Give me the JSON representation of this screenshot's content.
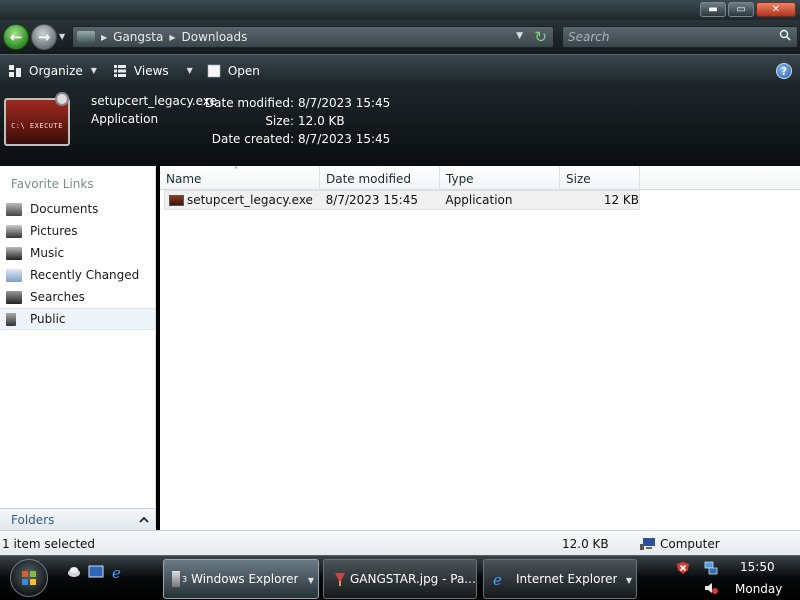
{
  "window": {
    "minimize_glyph": "▬",
    "maximize_glyph": "▭",
    "close_glyph": "✕"
  },
  "address": {
    "crumbs": [
      "Gangsta",
      "Downloads"
    ]
  },
  "search": {
    "placeholder": "Search"
  },
  "toolbar": {
    "organize": "Organize",
    "views": "Views",
    "open": "Open",
    "help": "?"
  },
  "details": {
    "thumbnail_text": "C:\\ EXECUTE",
    "name": "setupcert_legacy.exe",
    "type": "Application",
    "labels": [
      "Date modified:",
      "Size:",
      "Date created:"
    ],
    "values": [
      "8/7/2023 15:45",
      "12.0 KB",
      "8/7/2023 15:45"
    ]
  },
  "navpane": {
    "title": "Favorite Links",
    "items": [
      {
        "label": "Documents",
        "icon": "documents-icon"
      },
      {
        "label": "Pictures",
        "icon": "pictures-icon"
      },
      {
        "label": "Music",
        "icon": "music-icon"
      },
      {
        "label": "Recently Changed",
        "icon": "recently-changed-icon"
      },
      {
        "label": "Searches",
        "icon": "searches-icon"
      },
      {
        "label": "Public",
        "icon": "public-icon"
      }
    ],
    "folders_label": "Folders"
  },
  "filelist": {
    "columns": [
      "Name",
      "Date modified",
      "Type",
      "Size"
    ],
    "rows": [
      {
        "name": "setupcert_legacy.exe",
        "date": "8/7/2023 15:45",
        "type": "Application",
        "size": "12 KB"
      }
    ]
  },
  "status": {
    "selected": "1 item selected",
    "size": "12.0 KB",
    "location": "Computer"
  },
  "taskbar": {
    "tasks": [
      "Windows Explorer",
      "GANGSTAR.jpg - Pa...",
      "Internet Explorer"
    ],
    "explorer_count": "3",
    "time": "15:50",
    "day": "Monday"
  },
  "colors": {
    "chrome_dark": "#1f272c",
    "accent_green": "#2d8a1f",
    "link_blue": "#315e88",
    "selection": "#eef4fa"
  }
}
